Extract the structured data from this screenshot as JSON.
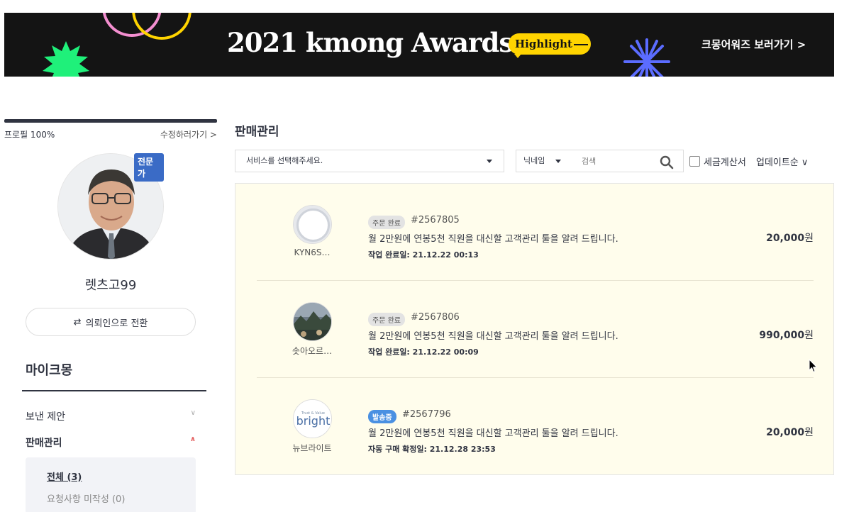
{
  "banner": {
    "title": "2021 kmong Awards",
    "highlight": "Highlight",
    "link": "크몽어워즈 보러가기 >"
  },
  "sidebar": {
    "profile_progress": "프로필 100%",
    "edit_link": "수정하러가기 >",
    "expert_badge": "전문가",
    "nickname": "렛츠고99",
    "switch_button": "의뢰인으로 전환",
    "section_title": "마이크몽",
    "menu": [
      {
        "label": "보낸 제안",
        "expanded": false
      },
      {
        "label": "판매관리",
        "expanded": true
      }
    ],
    "submenu": [
      {
        "label": "전체 (3)",
        "active": true
      },
      {
        "label": "요청사항 미작성 (0)",
        "active": false
      }
    ]
  },
  "main": {
    "title": "판매관리",
    "service_select": "서비스를 선택해주세요.",
    "search_type": "닉네임",
    "search_placeholder": "검색",
    "tax_invoice": "세금계산서",
    "sort": "업데이트순 ∨",
    "orders": [
      {
        "buyer": "KYN6S…",
        "status": "주문 완료",
        "order_no": "#2567805",
        "service": "월 2만원에 연봉5천 직원을 대신할 고객관리 툴을 알려 드립니다.",
        "meta": "작업 완료일: 21.12.22 00:13",
        "price": "20,000",
        "currency": "원"
      },
      {
        "buyer": "솟아오르…",
        "status": "주문 완료",
        "order_no": "#2567806",
        "service": "월 2만원에 연봉5천 직원을 대신할 고객관리 툴을 알려 드립니다.",
        "meta": "작업 완료일: 21.12.22 00:09",
        "price": "990,000",
        "currency": "원"
      },
      {
        "buyer": "뉴브라이트",
        "status": "발송중",
        "order_no": "#2567796",
        "service": "월 2만원에 연봉5천 직원을 대신할 고객관리 툴을 알려 드립니다.",
        "meta": "자동 구매 확정일: 21.12.28 23:53",
        "price": "20,000",
        "currency": "원"
      }
    ]
  },
  "logos": {
    "bright_small": "Trust & Value",
    "bright_word": "bright"
  },
  "colors": {
    "banner_bg": "#141414",
    "highlight": "#ffd400",
    "expert_badge": "#3a6bc6",
    "panel_bg": "#fffdec",
    "shipping_badge": "#4a90e2"
  }
}
